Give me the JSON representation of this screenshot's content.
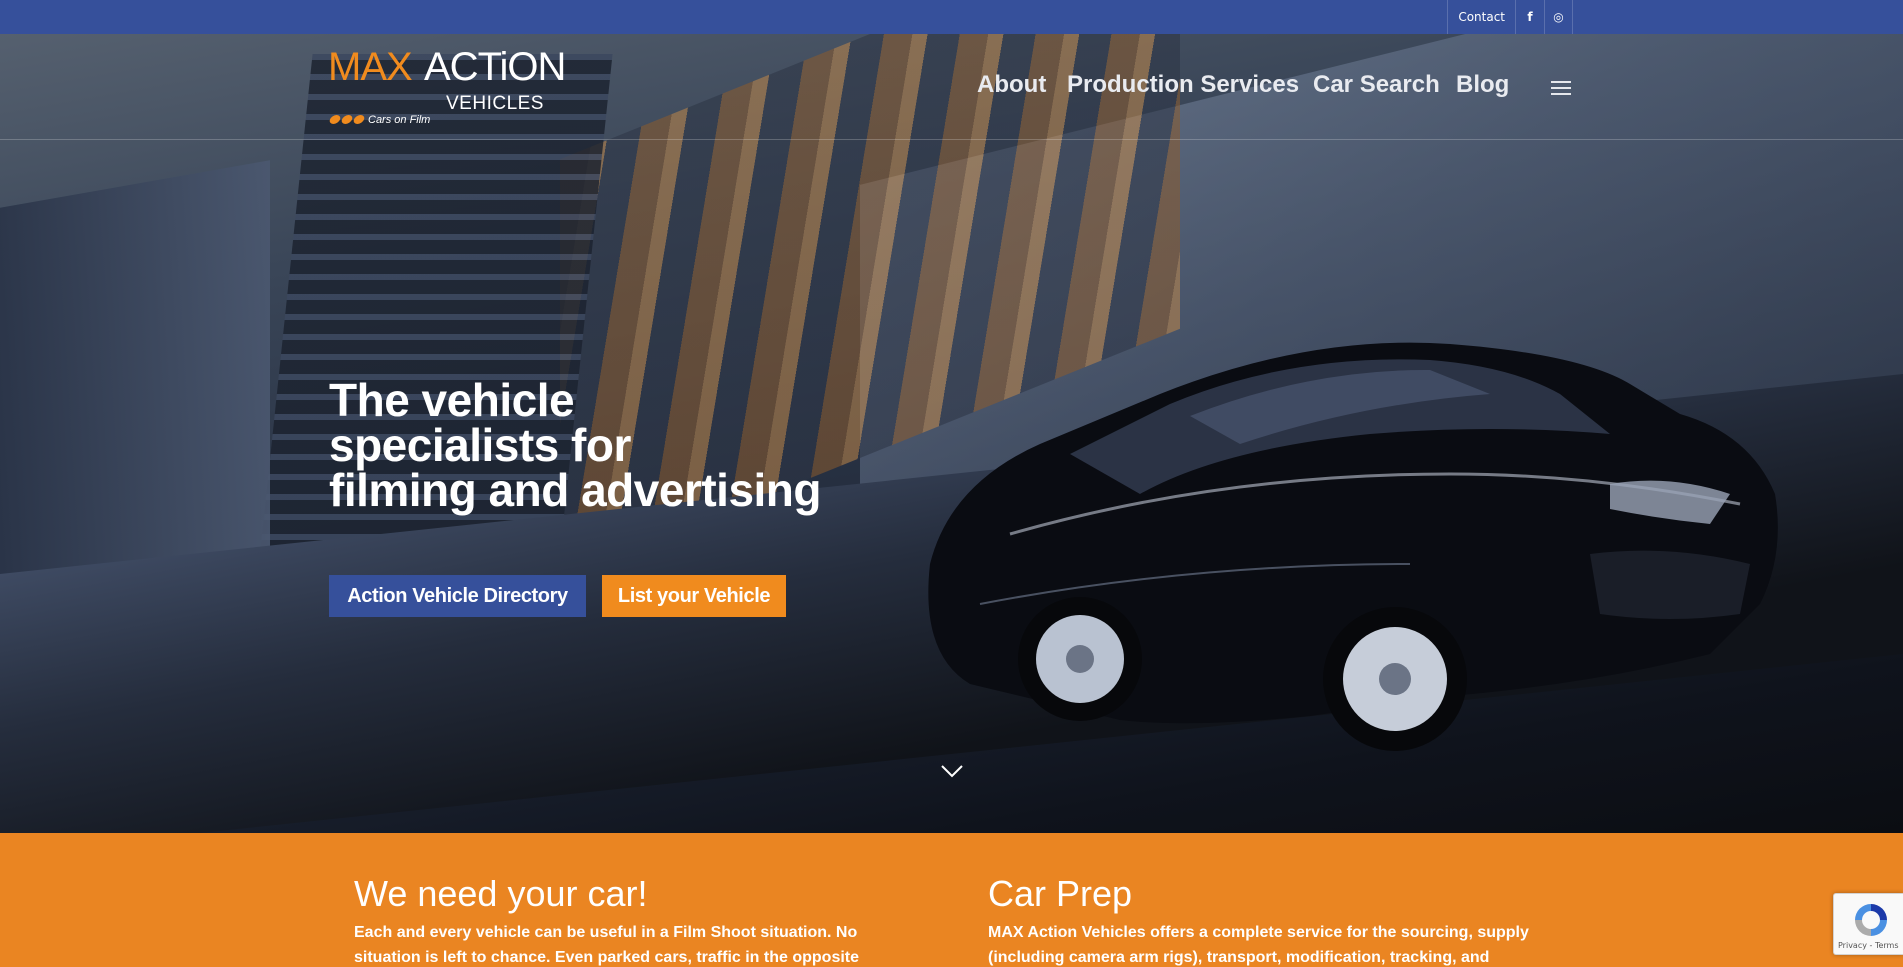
{
  "topbar": {
    "contact": "Contact",
    "facebook_icon": "f",
    "instagram_icon": "◎"
  },
  "logo": {
    "max": "MAX",
    "action": "ACTiON",
    "vehicles": "VEHICLES",
    "tagline": "Cars on Film"
  },
  "nav": {
    "items": [
      {
        "label": "About"
      },
      {
        "label": "Production Services"
      },
      {
        "label": "Car Search"
      },
      {
        "label": "Blog"
      }
    ],
    "menu_icon": "hamburger-menu-icon"
  },
  "hero": {
    "title_line1": "The vehicle",
    "title_line2": "specialists for",
    "title_line3": "filming and advertising",
    "primary_button": "Action Vehicle Directory",
    "secondary_button": "List your Vehicle",
    "scroll_icon": "chevron-down-icon"
  },
  "sections": [
    {
      "title": "We need your car!",
      "text_line1": "Each and every vehicle can be useful in a Film Shoot situation. No",
      "text_line2": "situation is left to chance. Even parked cars, traffic in the opposite"
    },
    {
      "title": "Car Prep",
      "text_line1": "MAX Action Vehicles offers a complete service for the sourcing, supply",
      "text_line2": "(including camera arm rigs), transport, modification, tracking, and"
    }
  ],
  "recaptcha": {
    "links": "Privacy - Terms"
  },
  "colors": {
    "brand_blue": "#36509b",
    "brand_orange": "#ea8522"
  }
}
